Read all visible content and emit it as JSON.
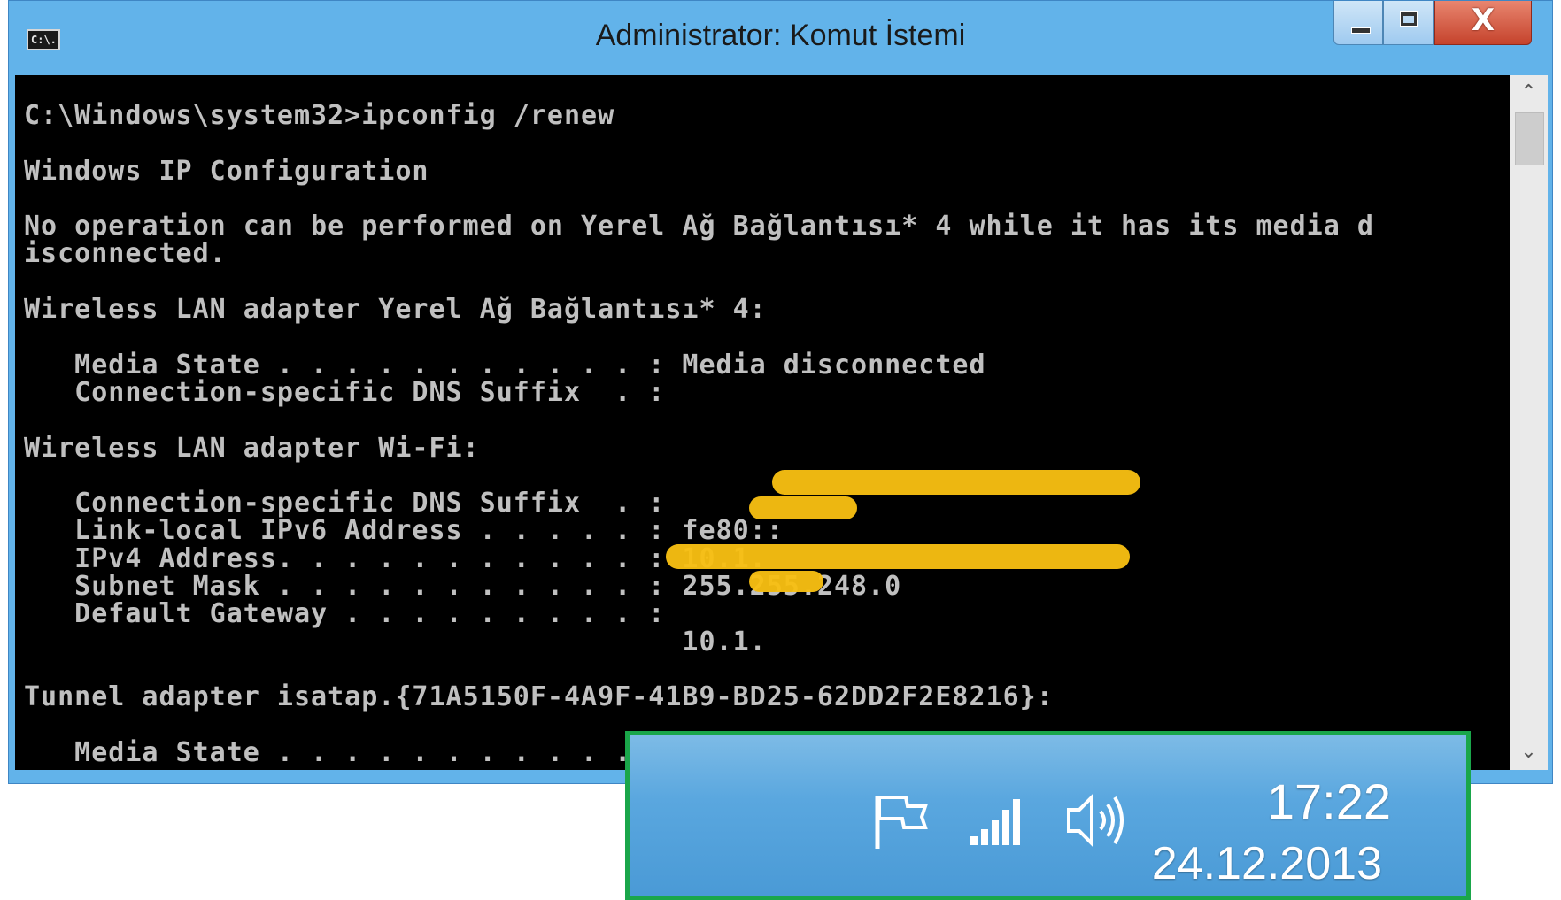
{
  "window": {
    "title": "Administrator: Komut İstemi",
    "app_icon_text": "C:\\.",
    "controls": {
      "minimize": "minimize",
      "maximize": "maximize",
      "close": "X"
    }
  },
  "console": {
    "text": "C:\\Windows\\system32>ipconfig /renew\n\nWindows IP Configuration\n\nNo operation can be performed on Yerel Ağ Bağlantısı* 4 while it has its media d\nisconnected.\n\nWireless LAN adapter Yerel Ağ Bağlantısı* 4:\n\n   Media State . . . . . . . . . . . : Media disconnected\n   Connection-specific DNS Suffix  . :\n\nWireless LAN adapter Wi-Fi:\n\n   Connection-specific DNS Suffix  . :\n   Link-local IPv6 Address . . . . . : fe80::\n   IPv4 Address. . . . . . . . . . . : 10.1.\n   Subnet Mask . . . . . . . . . . . : 255.255.248.0\n   Default Gateway . . . . . . . . . :\n                                       10.1.\n\nTunnel adapter isatap.{71A5150F-4A9F-41B9-BD25-62DD2F2E8216}:\n\n   Media State . . . . . . . . . . . : Media disconnected",
    "colors": {
      "background": "#000000",
      "text": "#c0c0c0",
      "redaction": "#f7be12"
    }
  },
  "scrollbar": {
    "up": "⌃",
    "down": "⌄"
  },
  "taskbar": {
    "icons": [
      "flag-icon",
      "signal-icon",
      "volume-icon"
    ],
    "time": "17:22",
    "date": "24.12.2013",
    "highlight_color": "#1aa64a"
  }
}
